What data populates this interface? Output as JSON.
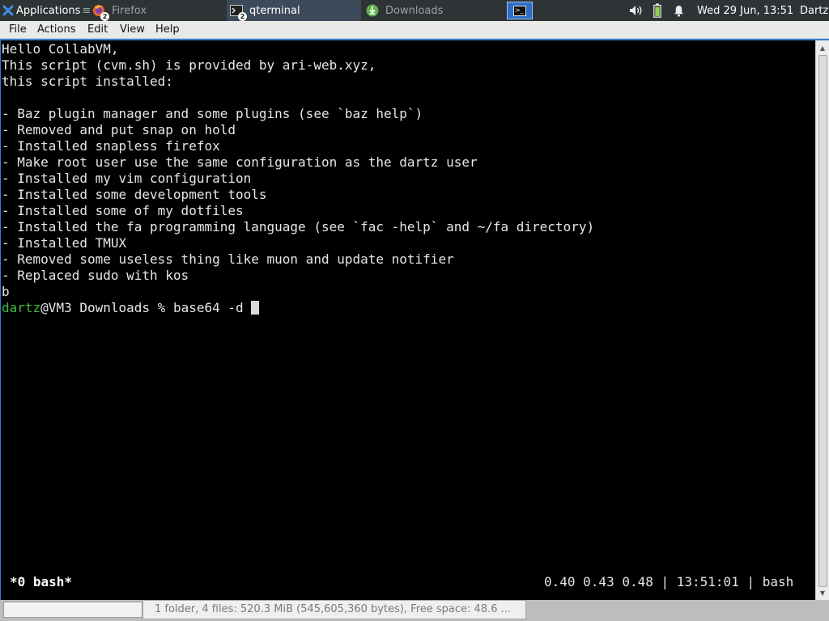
{
  "panel": {
    "applications_label": "Applications",
    "tasks": [
      {
        "label": "Firefox",
        "badge": "2",
        "active": false
      },
      {
        "label": "qterminal",
        "badge": "2",
        "active": true
      },
      {
        "label": "Downloads",
        "active": false
      }
    ],
    "clock": "Wed 29 Jun, 13:51",
    "user": "Dartz"
  },
  "menu": {
    "file": "File",
    "actions": "Actions",
    "edit": "Edit",
    "view": "View",
    "help": "Help"
  },
  "terminal": {
    "lines": [
      "Hello CollabVM,",
      "This script (cvm.sh) is provided by ari-web.xyz,",
      "this script installed:",
      "",
      "- Baz plugin manager and some plugins (see `baz help`)",
      "- Removed and put snap on hold",
      "- Installed snapless firefox",
      "- Make root user use the same configuration as the dartz user",
      "- Installed my vim configuration",
      "- Installed some development tools",
      "- Installed some of my dotfiles",
      "- Installed the fa programming language (see `fac -help` and ~/fa directory)",
      "- Installed TMUX",
      "- Removed some useless thing like muon and update notifier",
      "- Replaced sudo with kos",
      "b"
    ],
    "prompt": {
      "user": "dartz",
      "rest": "@VM3 Downloads % ",
      "command": "base64 -d "
    },
    "tmux_left": "*0 bash*",
    "tmux_right": "0.40 0.43 0.48 | 13:51:01 | bash"
  },
  "statusbar": {
    "text": "1 folder, 4 files: 520.3 MiB (545,605,360 bytes), Free space: 48.6 ..."
  },
  "colors": {
    "panel_bg": "#2e3436",
    "active_task": "#3d4a5a",
    "prompt_user": "#3fb93f",
    "window_frame": "#2f7fd0"
  }
}
